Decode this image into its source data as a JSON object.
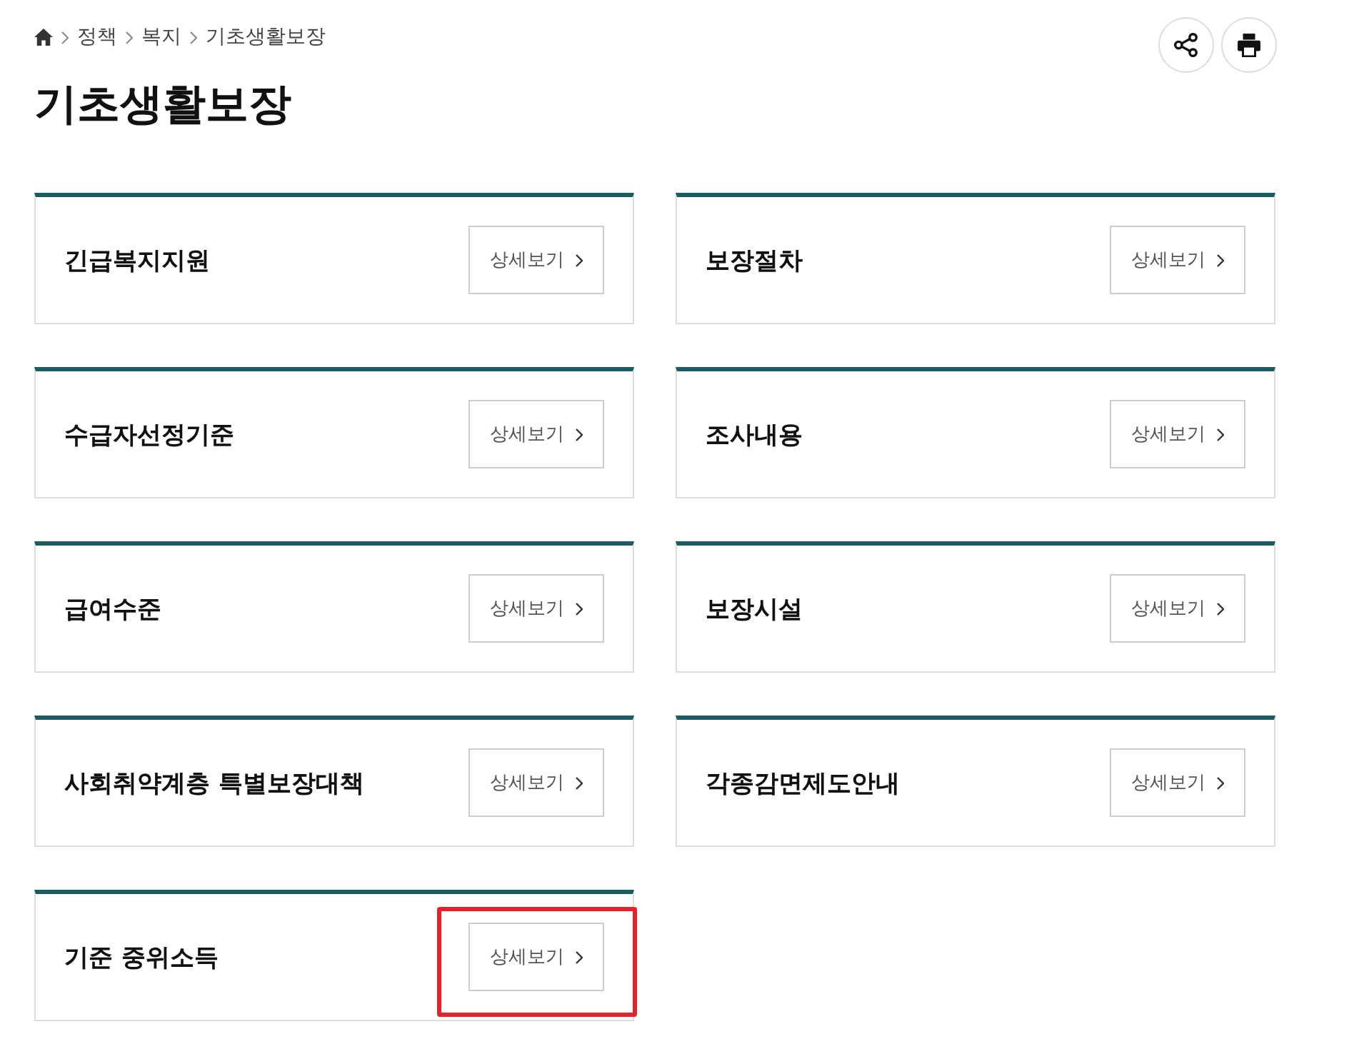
{
  "breadcrumb": {
    "items": [
      {
        "label": "정책"
      },
      {
        "label": "복지"
      },
      {
        "label": "기초생활보장"
      }
    ]
  },
  "title": "기초생활보장",
  "actions": [
    {
      "kind": "share"
    },
    {
      "kind": "print"
    }
  ],
  "cards": [
    {
      "title": "긴급복지지원",
      "button": "상세보기",
      "highlighted": false
    },
    {
      "title": "보장절차",
      "button": "상세보기",
      "highlighted": false
    },
    {
      "title": "수급자선정기준",
      "button": "상세보기",
      "highlighted": false
    },
    {
      "title": "조사내용",
      "button": "상세보기",
      "highlighted": false
    },
    {
      "title": "급여수준",
      "button": "상세보기",
      "highlighted": false
    },
    {
      "title": "보장시설",
      "button": "상세보기",
      "highlighted": false
    },
    {
      "title": "사회취약계층 특별보장대책",
      "button": "상세보기",
      "highlighted": false
    },
    {
      "title": "각종감면제도안내",
      "button": "상세보기",
      "highlighted": false
    },
    {
      "title": "기준 중위소득",
      "button": "상세보기",
      "highlighted": true
    }
  ]
}
